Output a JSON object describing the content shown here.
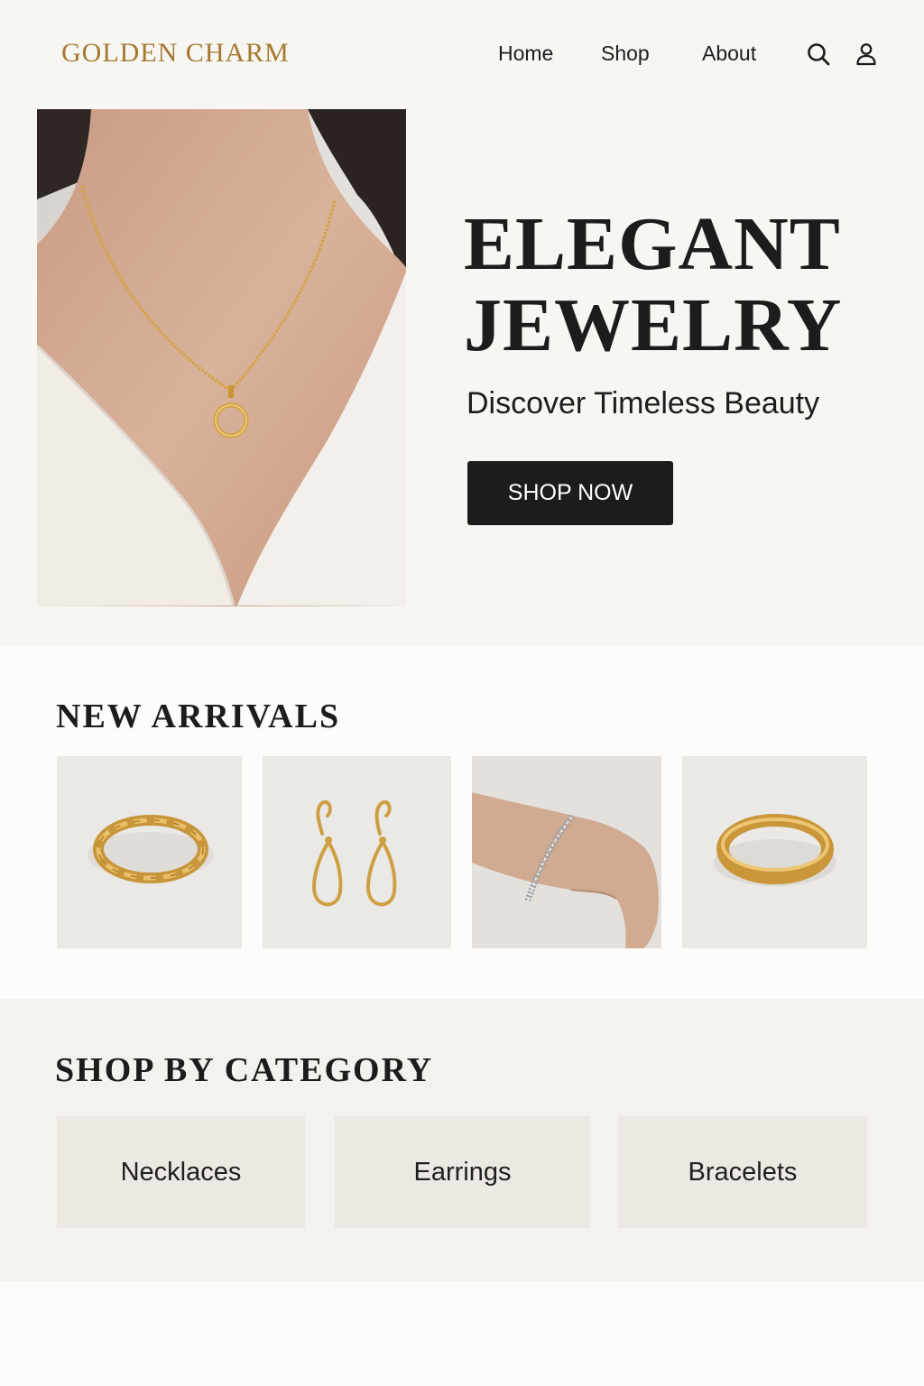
{
  "brand": {
    "name": "GOLDEN CHARM",
    "color": "#a5792f"
  },
  "nav": {
    "home": "Home",
    "shop": "Shop",
    "about": "About"
  },
  "header_icons": [
    "search-icon",
    "user-icon"
  ],
  "hero": {
    "title_line1": "ELEGANT",
    "title_line2": "JEWELRY",
    "subtitle": "Discover Timeless Beauty",
    "cta": "SHOP NOW",
    "image": "woman wearing gold chain necklace with circle pendant"
  },
  "new_arrivals": {
    "title": "NEW ARRIVALS",
    "products": [
      {
        "image": "twisted gold ring"
      },
      {
        "image": "gold teardrop earrings"
      },
      {
        "image": "silver beaded bracelet on wrist"
      },
      {
        "image": "gold band ring"
      }
    ]
  },
  "categories": {
    "title": "SHOP BY CATEGORY",
    "items": [
      "Necklaces",
      "Earrings",
      "Bracelets"
    ]
  },
  "colors": {
    "accent": "#a5792f",
    "button": "#1c1c1c",
    "gold": "#d4a447"
  }
}
